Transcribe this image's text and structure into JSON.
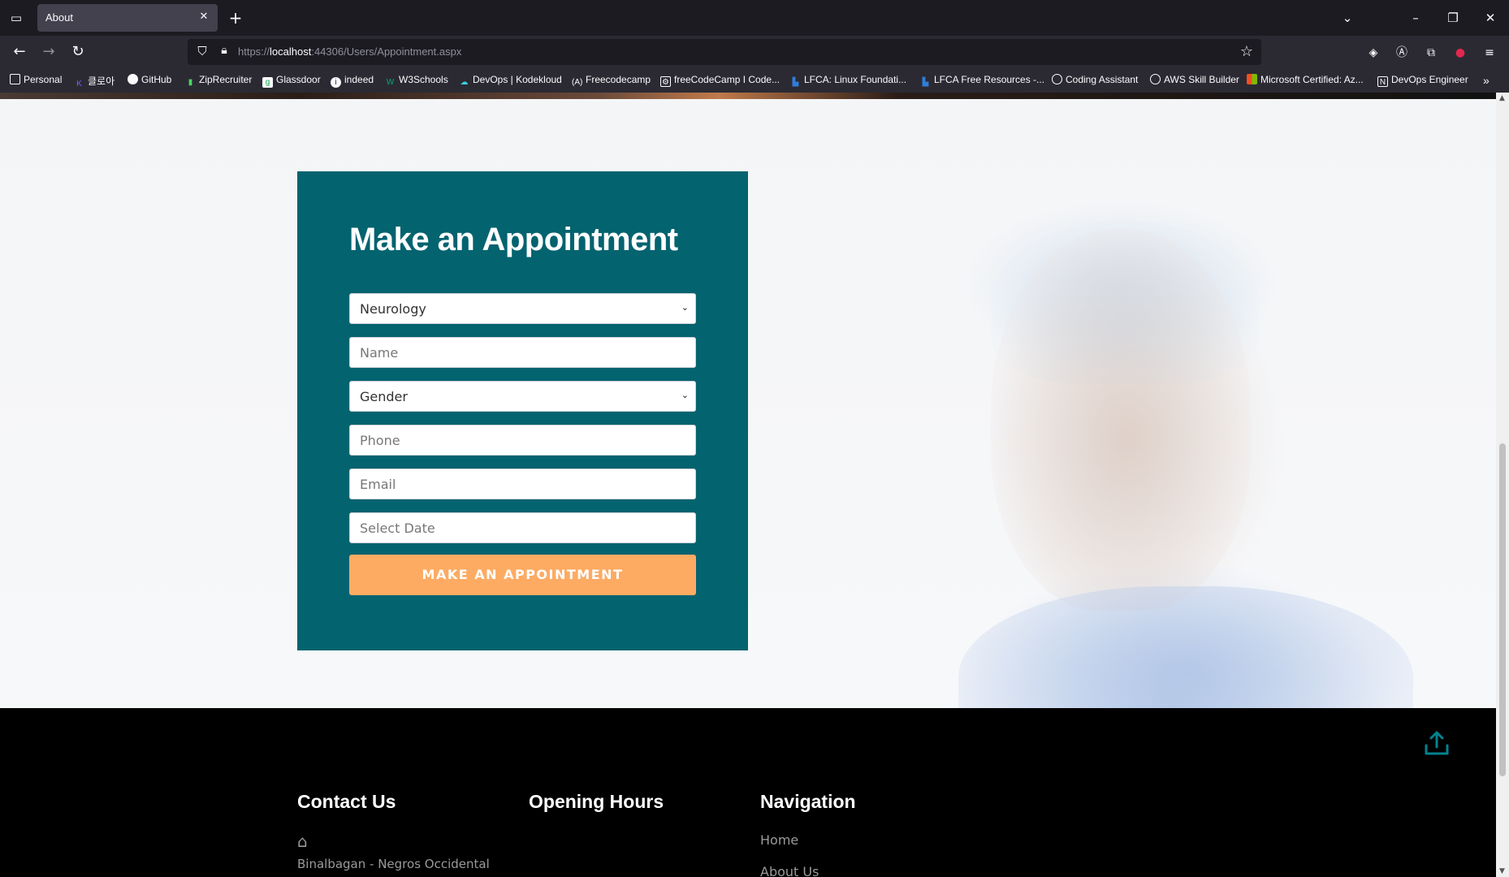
{
  "browser": {
    "tab_title": "About",
    "url_prefix": "https://",
    "url_host": "localhost",
    "url_rest": ":44306/Users/Appointment.aspx",
    "bookmarks": [
      {
        "label": "Personal",
        "icon": "folder-icon"
      },
      {
        "label": "클로아",
        "icon": "k-icon"
      },
      {
        "label": "GitHub",
        "icon": "github-icon"
      },
      {
        "label": "ZipRecruiter",
        "icon": "ziprecruiter-icon"
      },
      {
        "label": "Glassdoor",
        "icon": "glassdoor-icon"
      },
      {
        "label": "indeed",
        "icon": "indeed-icon"
      },
      {
        "label": "W3Schools",
        "icon": "w3schools-icon"
      },
      {
        "label": "DevOps | Kodekloud",
        "icon": "kodekloud-icon"
      },
      {
        "label": "Freecodecamp",
        "icon": "freecodecamp-icon"
      },
      {
        "label": "freeCodeCamp I Code...",
        "icon": "freecodecamp-icon"
      },
      {
        "label": "LFCA: Linux Foundati...",
        "icon": "linux-foundation-icon"
      },
      {
        "label": "LFCA Free Resources -...",
        "icon": "linux-foundation-icon"
      },
      {
        "label": "Coding Assistant",
        "icon": "openai-icon"
      },
      {
        "label": "AWS Skill Builder",
        "icon": "globe-icon"
      },
      {
        "label": "Microsoft Certified: Az...",
        "icon": "microsoft-icon"
      },
      {
        "label": "DevOps Engineer",
        "icon": "notion-icon"
      }
    ]
  },
  "appointment": {
    "title": "Make an Appointment",
    "department_value": "Neurology",
    "name_placeholder": "Name",
    "gender_value": "Gender",
    "phone_placeholder": "Phone",
    "email_placeholder": "Email",
    "date_placeholder": "Select Date",
    "submit_label": "MAKE AN APPOINTMENT",
    "card_color": "#03636f",
    "button_color": "#fdab63"
  },
  "footer": {
    "contact_heading": "Contact Us",
    "address": "Binalbagan - Negros Occidental",
    "hours_heading": "Opening Hours",
    "nav_heading": "Navigation",
    "nav_links": [
      "Home",
      "About Us"
    ]
  }
}
